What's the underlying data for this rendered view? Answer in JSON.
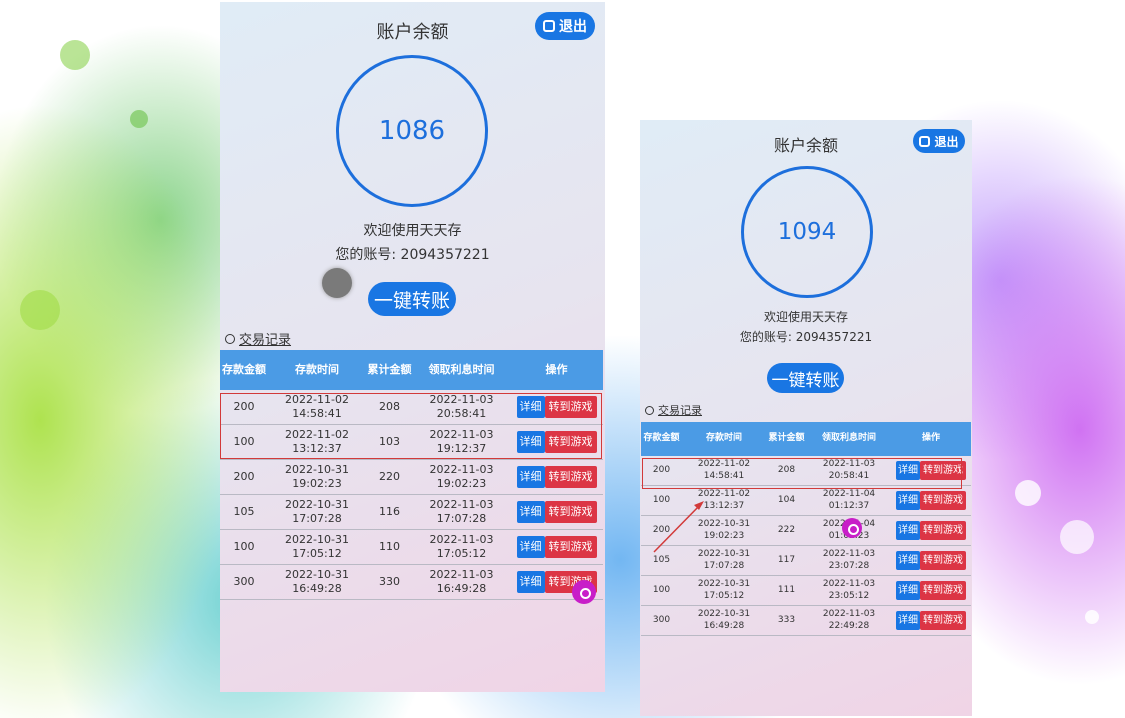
{
  "screen_a": {
    "title": "账户余额",
    "logout_label": "退出",
    "balance": "1086",
    "welcome": "欢迎使用天天存",
    "account_line": "您的账号: 2094357221",
    "transfer_label": "一键转账",
    "history_label": "交易记录",
    "table": {
      "headers": [
        "存款金额",
        "存款时间",
        "累计金额",
        "领取利息时间",
        "操作"
      ],
      "rows": [
        {
          "amount": "200",
          "deposit_time": "2022-11-02 14:58:41",
          "total": "208",
          "interest_time": "2022-11-03 20:58:41"
        },
        {
          "amount": "100",
          "deposit_time": "2022-11-02 13:12:37",
          "total": "103",
          "interest_time": "2022-11-03 19:12:37"
        },
        {
          "amount": "200",
          "deposit_time": "2022-10-31 19:02:23",
          "total": "220",
          "interest_time": "2022-11-03 19:02:23"
        },
        {
          "amount": "105",
          "deposit_time": "2022-10-31 17:07:28",
          "total": "116",
          "interest_time": "2022-11-03 17:07:28"
        },
        {
          "amount": "100",
          "deposit_time": "2022-10-31 17:05:12",
          "total": "110",
          "interest_time": "2022-11-03 17:05:12"
        },
        {
          "amount": "300",
          "deposit_time": "2022-10-31 16:49:28",
          "total": "330",
          "interest_time": "2022-11-03 16:49:28"
        }
      ],
      "detail_label": "详细",
      "game_label": "转到游戏"
    }
  },
  "screen_b": {
    "title": "账户余额",
    "logout_label": "退出",
    "balance": "1094",
    "welcome": "欢迎使用天天存",
    "account_line": "您的账号: 2094357221",
    "transfer_label": "一键转账",
    "history_label": "交易记录",
    "table": {
      "headers": [
        "存款金额",
        "存款时间",
        "累计金额",
        "领取利息时间",
        "操作"
      ],
      "rows": [
        {
          "amount": "200",
          "deposit_time": "2022-11-02 14:58:41",
          "total": "208",
          "interest_time": "2022-11-03 20:58:41"
        },
        {
          "amount": "100",
          "deposit_time": "2022-11-02 13:12:37",
          "total": "104",
          "interest_time": "2022-11-04 01:12:37"
        },
        {
          "amount": "200",
          "deposit_time": "2022-10-31 19:02:23",
          "total": "222",
          "interest_time": "2022-11-04 01:02:23"
        },
        {
          "amount": "105",
          "deposit_time": "2022-10-31 17:07:28",
          "total": "117",
          "interest_time": "2022-11-03 23:07:28"
        },
        {
          "amount": "100",
          "deposit_time": "2022-10-31 17:05:12",
          "total": "111",
          "interest_time": "2022-11-03 23:05:12"
        },
        {
          "amount": "300",
          "deposit_time": "2022-10-31 16:49:28",
          "total": "333",
          "interest_time": "2022-11-03 22:49:28"
        }
      ],
      "detail_label": "详细",
      "game_label": "转到游戏"
    }
  },
  "colors": {
    "accent_blue": "#1976e3",
    "header_blue": "#4b9be5",
    "game_red": "#dc3545",
    "highlight_red": "#d23a3a",
    "marker_magenta": "#c81ec8"
  },
  "icons": {
    "logout": "logout-icon",
    "history": "history-clock-icon",
    "marker": "location-marker-icon"
  }
}
